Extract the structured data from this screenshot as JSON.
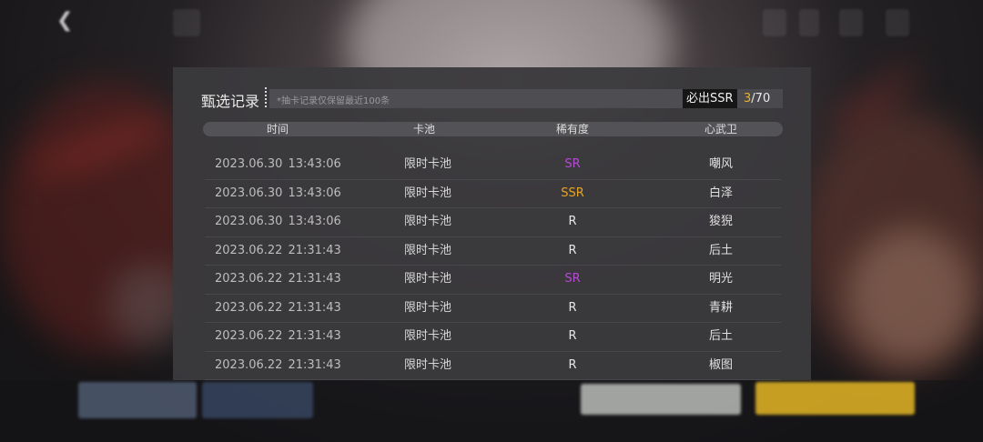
{
  "dialog": {
    "title": "甄选记录",
    "note": "*抽卡记录仅保留最近100条",
    "pity": {
      "label": "必出SSR",
      "current": "3",
      "separator": "/",
      "total": "70"
    },
    "columns": [
      "时间",
      "卡池",
      "稀有度",
      "心武卫"
    ],
    "rows": [
      {
        "date": "2023.06.30",
        "time": "13:43:06",
        "pool": "限时卡池",
        "rarity": "SR",
        "name": "嘲风"
      },
      {
        "date": "2023.06.30",
        "time": "13:43:06",
        "pool": "限时卡池",
        "rarity": "SSR",
        "name": "白泽"
      },
      {
        "date": "2023.06.30",
        "time": "13:43:06",
        "pool": "限时卡池",
        "rarity": "R",
        "name": "狻猊"
      },
      {
        "date": "2023.06.22",
        "time": "21:31:43",
        "pool": "限时卡池",
        "rarity": "R",
        "name": "后土"
      },
      {
        "date": "2023.06.22",
        "time": "21:31:43",
        "pool": "限时卡池",
        "rarity": "SR",
        "name": "明光"
      },
      {
        "date": "2023.06.22",
        "time": "21:31:43",
        "pool": "限时卡池",
        "rarity": "R",
        "name": "青耕"
      },
      {
        "date": "2023.06.22",
        "time": "21:31:43",
        "pool": "限时卡池",
        "rarity": "R",
        "name": "后土"
      },
      {
        "date": "2023.06.22",
        "time": "21:31:43",
        "pool": "限时卡池",
        "rarity": "R",
        "name": "椒图"
      }
    ]
  },
  "colors": {
    "sr": "#b64ad6",
    "ssr": "#e8a424",
    "pity_current": "#e8b12a"
  },
  "topbar": {
    "back_icon": "back-arrow-icon"
  }
}
